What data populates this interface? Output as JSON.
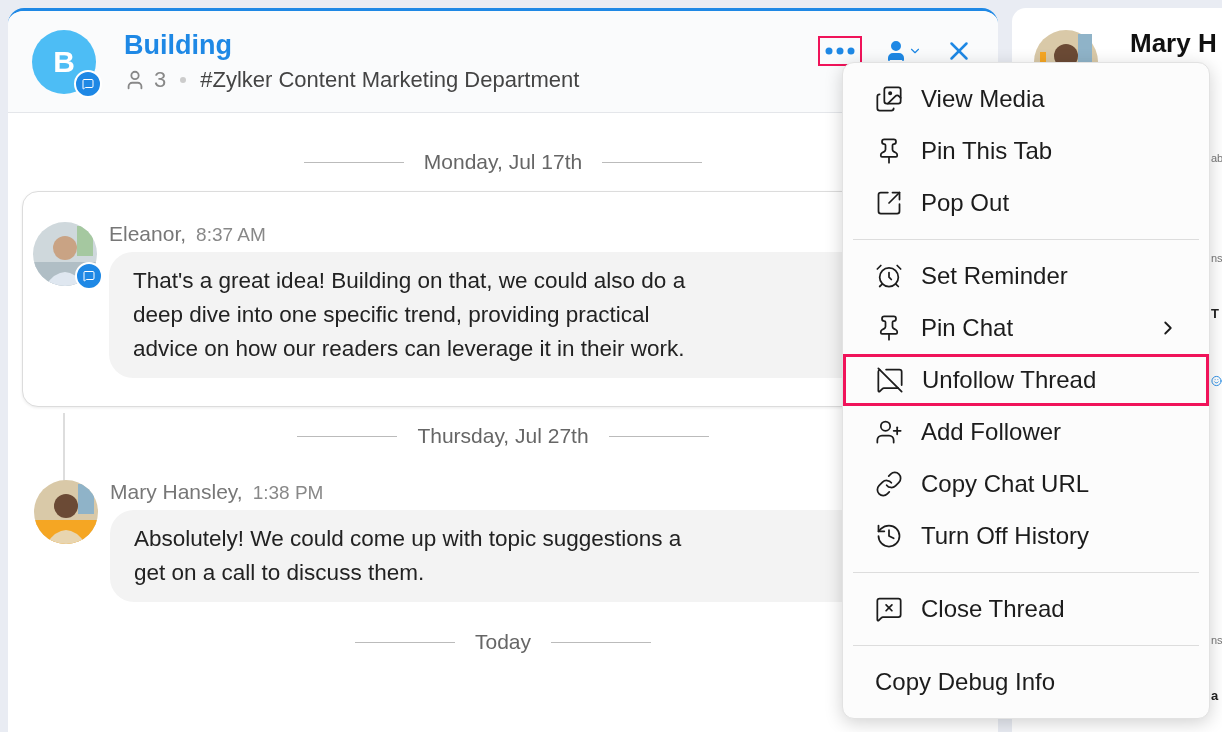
{
  "header": {
    "avatar_letter": "B",
    "title": "Building",
    "member_count": "3",
    "channel": "#Zylker Content Marketing Department",
    "more_button": {
      "highlighted": true
    }
  },
  "thread": [
    {
      "kind": "date",
      "label": "Monday, Jul 17th"
    },
    {
      "kind": "message",
      "highlighted": true,
      "badge": true,
      "author": "Eleanor,",
      "time": "8:37 AM",
      "lines": [
        "That's a great idea! Building on that, we could also do a",
        "deep dive into one specific trend, providing practical",
        "advice on how our readers can leverage it in their work."
      ]
    },
    {
      "kind": "date",
      "label": "Thursday, Jul 27th"
    },
    {
      "kind": "message",
      "highlighted": false,
      "badge": false,
      "author": "Mary Hansley,",
      "time": "1:38 PM",
      "lines": [
        "Absolutely! We could come up with topic suggestions a",
        "get on a call to discuss them."
      ]
    },
    {
      "kind": "date",
      "label": "Today"
    }
  ],
  "menu": [
    {
      "kind": "item",
      "label": "View Media",
      "submenu": false,
      "highlighted": false
    },
    {
      "kind": "item",
      "label": "Pin This Tab",
      "submenu": false,
      "highlighted": false
    },
    {
      "kind": "item",
      "label": "Pop Out",
      "submenu": false,
      "highlighted": false
    },
    {
      "kind": "separator"
    },
    {
      "kind": "item",
      "label": "Set Reminder",
      "submenu": false,
      "highlighted": false
    },
    {
      "kind": "item",
      "label": "Pin Chat",
      "submenu": true,
      "highlighted": false
    },
    {
      "kind": "item",
      "label": "Unfollow Thread",
      "submenu": false,
      "highlighted": true
    },
    {
      "kind": "item",
      "label": "Add Follower",
      "submenu": false,
      "highlighted": false
    },
    {
      "kind": "item",
      "label": "Copy Chat URL",
      "submenu": false,
      "highlighted": false
    },
    {
      "kind": "item",
      "label": "Turn Off History",
      "submenu": false,
      "highlighted": false
    },
    {
      "kind": "separator"
    },
    {
      "kind": "item",
      "label": "Close Thread",
      "submenu": false,
      "highlighted": false
    },
    {
      "kind": "separator"
    },
    {
      "kind": "item",
      "label": "Copy Debug Info",
      "submenu": false,
      "highlighted": false
    }
  ],
  "right_panel": {
    "name": "Mary H",
    "fragments": [
      {
        "kind": "muted",
        "text": "ab"
      },
      {
        "kind": "muted",
        "text": "ns"
      },
      {
        "kind": "strong",
        "text": "T"
      },
      {
        "kind": "icon"
      },
      {
        "kind": "muted",
        "text": "ns"
      },
      {
        "kind": "strong",
        "text": "a"
      }
    ]
  }
}
